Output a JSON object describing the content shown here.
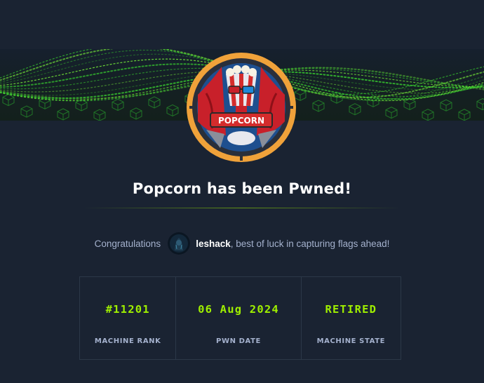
{
  "accent_color": "#9fef00",
  "background_color": "#1a2332",
  "badge": {
    "logo_text": "POPCORN",
    "icon": "popcorn-machine-badge"
  },
  "title": "Popcorn has been Pwned!",
  "congrats": {
    "prefix": "Congratulations",
    "username": "leshack",
    "suffix": ", best of luck in capturing flags ahead!",
    "avatar_icon": "user-avatar"
  },
  "stats": [
    {
      "value": "#11201",
      "label": "MACHINE RANK"
    },
    {
      "value": "06 Aug 2024",
      "label": "PWN DATE"
    },
    {
      "value": "RETIRED",
      "label": "MACHINE STATE"
    }
  ]
}
